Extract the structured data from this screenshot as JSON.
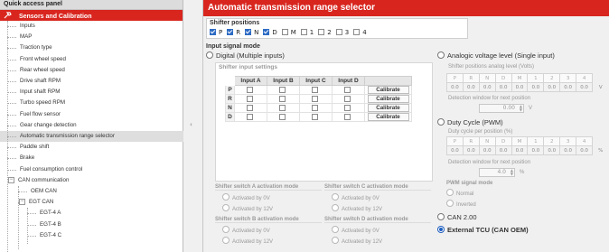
{
  "left_panel": {
    "title": "Quick access panel",
    "category": "Sensors and Calibration",
    "items": [
      {
        "label": "Inputs",
        "level": 1
      },
      {
        "label": "MAP",
        "level": 1
      },
      {
        "label": "Traction type",
        "level": 1
      },
      {
        "label": "Front wheel speed",
        "level": 1
      },
      {
        "label": "Rear wheel speed",
        "level": 1
      },
      {
        "label": "Drive shaft RPM",
        "level": 1
      },
      {
        "label": "Input shaft RPM",
        "level": 1
      },
      {
        "label": "Turbo speed RPM",
        "level": 1
      },
      {
        "label": "Fuel flow sensor",
        "level": 1
      },
      {
        "label": "Gear change detection",
        "level": 1
      },
      {
        "label": "Automatic transmission range selector",
        "level": 1,
        "selected": true
      },
      {
        "label": "Paddle shift",
        "level": 1
      },
      {
        "label": "Brake",
        "level": 1
      },
      {
        "label": "Fuel consumption control",
        "level": 1
      },
      {
        "label": "CAN communication",
        "level": 1,
        "expander": "−"
      },
      {
        "label": "OEM CAN",
        "level": 2
      },
      {
        "label": "EGT CAN",
        "level": 2,
        "expander": "−"
      },
      {
        "label": "EGT-4 A",
        "level": 3
      },
      {
        "label": "EGT-4 B",
        "level": 3
      },
      {
        "label": "EGT-4 C",
        "level": 3
      }
    ]
  },
  "right_panel": {
    "title": "Automatic transmission range selector",
    "shifter_positions": {
      "title": "Shifter positions",
      "items": [
        {
          "label": "P",
          "checked": true
        },
        {
          "label": "R",
          "checked": true
        },
        {
          "label": "N",
          "checked": true
        },
        {
          "label": "D",
          "checked": true
        },
        {
          "label": "M",
          "checked": false
        },
        {
          "label": "1",
          "checked": false
        },
        {
          "label": "2",
          "checked": false
        },
        {
          "label": "3",
          "checked": false
        },
        {
          "label": "4",
          "checked": false
        }
      ]
    },
    "input_signal_mode": "Input signal mode",
    "digital": {
      "label": "Digital (Multiple inputs)",
      "selected": false,
      "settings_title": "Shifter input settings",
      "columns": [
        "Input A",
        "Input B",
        "Input C",
        "Input D"
      ],
      "rows": [
        "P",
        "R",
        "N",
        "D"
      ],
      "calibrate_label": "Calibrate",
      "switch_modes": [
        {
          "title": "Shifter switch A activation mode",
          "options": [
            "Activated by 0V",
            "Activated by 12V"
          ]
        },
        {
          "title": "Shifter switch C activation mode",
          "options": [
            "Activated by 0V",
            "Activated by 12V"
          ]
        },
        {
          "title": "Shifter switch B activation mode",
          "options": [
            "Activated by 0V",
            "Activated by 12V"
          ]
        },
        {
          "title": "Shifter switch D activation mode",
          "options": [
            "Activated by 0V",
            "Activated by 12V"
          ]
        }
      ]
    },
    "analog": {
      "label": "Analogic voltage level (Single input)",
      "selected": false,
      "table_title": "Shifter positions analog level (Volts)",
      "headers": [
        "P",
        "R",
        "N",
        "D",
        "M",
        "1",
        "2",
        "3",
        "4"
      ],
      "values": [
        "0.0",
        "0.0",
        "0.0",
        "0.0",
        "0.0",
        "0.0",
        "0.0",
        "0.0",
        "0.0"
      ],
      "unit": "V",
      "window_label": "Detection window for next position",
      "window_value": "0.00",
      "window_unit": "V"
    },
    "pwm": {
      "label": "Duty Cycle (PWM)",
      "selected": false,
      "table_title": "Duty cycle per position (%)",
      "headers": [
        "P",
        "R",
        "N",
        "D",
        "M",
        "1",
        "2",
        "3",
        "4"
      ],
      "values": [
        "0.0",
        "0.0",
        "0.0",
        "0.0",
        "0.0",
        "0.0",
        "0.0",
        "0.0",
        "0.0"
      ],
      "unit": "%",
      "window_label": "Detection window for next position",
      "window_value": "4.0",
      "window_unit": "%",
      "signal_title": "PWM signal mode",
      "signal_options": [
        "Normal",
        "Inverted"
      ]
    },
    "can": {
      "label": "CAN 2.00",
      "selected": false
    },
    "external": {
      "label": "External TCU (CAN OEM)",
      "selected": true
    }
  },
  "icons": {
    "category_icon": "tools-icon",
    "splitter_icon": "collapse-arrow-icon"
  },
  "colors": {
    "accent": "#d8261f",
    "check": "#2d6bc4",
    "selected_item": "#dedede"
  }
}
